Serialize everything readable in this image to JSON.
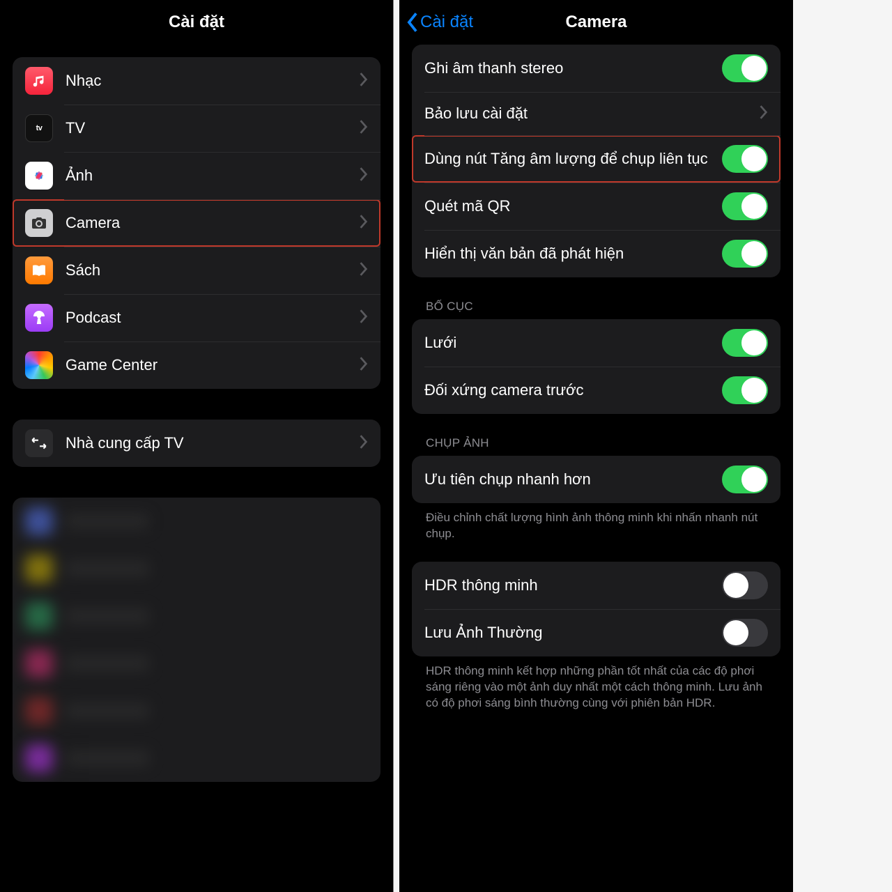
{
  "left": {
    "title": "Cài đặt",
    "group1": [
      {
        "label": "Nhạc",
        "icon": "music-icon"
      },
      {
        "label": "TV",
        "icon": "tv-icon"
      },
      {
        "label": "Ảnh",
        "icon": "photos-icon"
      },
      {
        "label": "Camera",
        "icon": "camera-icon",
        "highlight": true
      },
      {
        "label": "Sách",
        "icon": "books-icon"
      },
      {
        "label": "Podcast",
        "icon": "podcast-icon"
      },
      {
        "label": "Game Center",
        "icon": "gamecenter-icon"
      }
    ],
    "group2": [
      {
        "label": "Nhà cung cấp TV",
        "icon": "tvprovider-icon"
      }
    ]
  },
  "right": {
    "back": "Cài đặt",
    "title": "Camera",
    "rows": {
      "r0": "Ghi âm thanh stereo",
      "r1": "Bảo lưu cài đặt",
      "r2": "Dùng nút Tăng âm lượng để chụp liên tục",
      "r3": "Quét mã QR",
      "r4": "Hiển thị văn bản đã phát hiện",
      "sec1": "BỐ CỤC",
      "r5": "Lưới",
      "r6": "Đối xứng camera trước",
      "sec2": "CHỤP ẢNH",
      "r7": "Ưu tiên chụp nhanh hơn",
      "foot1": "Điều chỉnh chất lượng hình ảnh thông minh khi nhấn nhanh nút chụp.",
      "r8": "HDR thông minh",
      "r9": "Lưu Ảnh Thường",
      "foot2": "HDR thông minh kết hợp những phần tốt nhất của các độ phơi sáng riêng vào một ảnh duy nhất một cách thông minh. Lưu ảnh có độ phơi sáng bình thường cùng với phiên bản HDR."
    }
  }
}
